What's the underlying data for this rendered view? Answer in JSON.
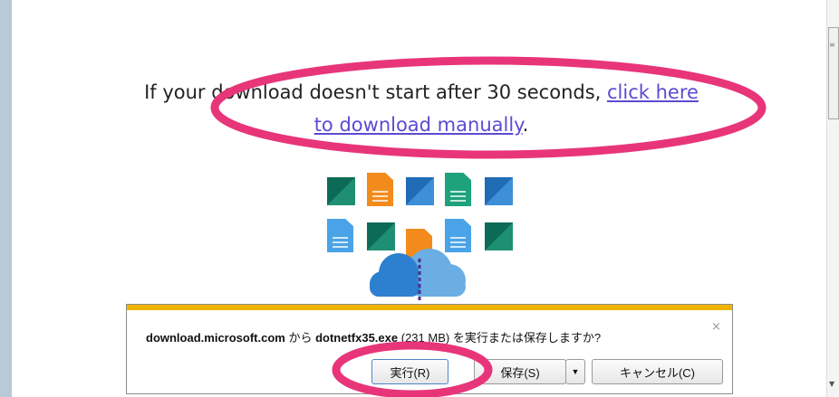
{
  "message": {
    "text_before": "If your download doesn't start after 30 seconds, ",
    "link": "click here to download manually",
    "text_after": "."
  },
  "download_bar": {
    "domain": "download.microsoft.com",
    "from_text": " から ",
    "filename": "dotnetfx35.exe",
    "size": " (231 MB) ",
    "question": "を実行または保存しますか?",
    "close_glyph": "×",
    "run_label": "実行(R)",
    "save_label": "保存(S)",
    "dropdown_glyph": "▼",
    "cancel_label": "キャンセル(C)"
  },
  "scrollbar": {
    "grip_glyph": "≡",
    "down_glyph": "▼"
  },
  "colors": {
    "link": "#5b4bd1",
    "highlight_annotation": "#e8357a",
    "notification_accent": "#f0b400"
  }
}
